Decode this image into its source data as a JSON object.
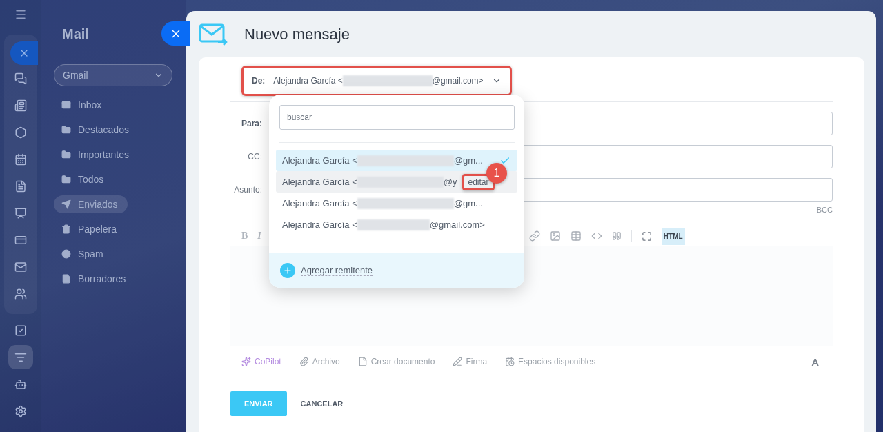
{
  "rail": {
    "items": [
      {
        "selected": false
      },
      {
        "selected": false
      },
      {
        "selected": false
      },
      {
        "selected": false
      },
      {
        "selected": false
      },
      {
        "selected": false
      },
      {
        "selected": false
      },
      {
        "selected": false
      },
      {
        "selected": false
      },
      {
        "selected": false
      },
      {
        "selected": true
      },
      {
        "selected": false
      },
      {
        "selected": false
      }
    ]
  },
  "mail_panel": {
    "title": "Mail",
    "account": "Gmail",
    "folders": [
      {
        "label": "Inbox",
        "selected": false
      },
      {
        "label": "Destacados",
        "selected": false
      },
      {
        "label": "Importantes",
        "selected": false
      },
      {
        "label": "Todos",
        "selected": false
      },
      {
        "label": "Enviados",
        "selected": true
      },
      {
        "label": "Papelera",
        "selected": false
      },
      {
        "label": "Spam",
        "selected": false
      },
      {
        "label": "Borradores",
        "selected": false
      }
    ]
  },
  "compose": {
    "title": "Nuevo mensaje",
    "from": {
      "label": "De:",
      "name": "Alejandra García <",
      "suffix": "@gmail.com>"
    },
    "sender_menu": {
      "search": {
        "placeholder": "buscar"
      },
      "senders": [
        {
          "name": "Alejandra García <",
          "suffix": "@gm...",
          "selected": true,
          "hovered": false
        },
        {
          "name": "Alejandra García <",
          "suffix": "@y",
          "selected": false,
          "hovered": true,
          "action": "editar"
        },
        {
          "name": "Alejandra García <",
          "suffix": "@gm...",
          "selected": false,
          "hovered": false
        },
        {
          "name": "Alejandra García <",
          "suffix": "@gmail.com>",
          "selected": false,
          "hovered": false
        }
      ],
      "add": "Agregar remitente"
    },
    "callout": "1",
    "fields": [
      {
        "label": "Para:"
      },
      {
        "label": "CC:"
      },
      {
        "label": "Asunto:"
      }
    ],
    "bcc": "BCC",
    "toolbar": {
      "bold": "B",
      "italic": "I",
      "html": "HTML",
      "html_on": true
    },
    "actions": [
      {
        "label": "CoPilot",
        "kind": "copilot"
      },
      {
        "label": "Archivo",
        "kind": "attach"
      },
      {
        "label": "Crear documento",
        "kind": "doc"
      },
      {
        "label": "Firma",
        "kind": "sign"
      },
      {
        "label": "Espacios disponibles",
        "kind": "slots"
      }
    ],
    "font_button": "A",
    "send": "ENVIAR",
    "cancel": "CANCELAR"
  }
}
